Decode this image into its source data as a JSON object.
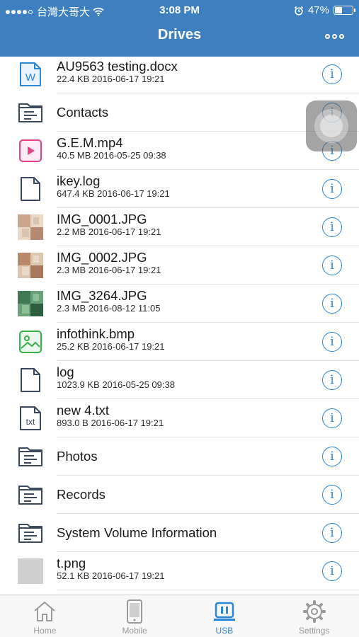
{
  "status_bar": {
    "carrier": "台灣大哥大",
    "time": "3:08 PM",
    "battery_level": 47,
    "battery_text": "47%"
  },
  "nav": {
    "title": "Drives",
    "more_icon": "more-dots-icon"
  },
  "files": [
    {
      "name": "AU9563 testing.docx",
      "meta": "22.4 KB 2016-06-17 19:21",
      "icon": "word-doc-icon"
    },
    {
      "name": "Contacts",
      "meta": "",
      "icon": "folder-icon"
    },
    {
      "name": "G.E.M.mp4",
      "meta": "40.5 MB 2016-05-25 09:38",
      "icon": "video-file-icon"
    },
    {
      "name": "ikey.log",
      "meta": "647.4 KB 2016-06-17 19:21",
      "icon": "file-icon"
    },
    {
      "name": "IMG_0001.JPG",
      "meta": "2.2 MB 2016-06-17 19:21",
      "icon": "photo-thumbnail"
    },
    {
      "name": "IMG_0002.JPG",
      "meta": "2.3 MB 2016-06-17 19:21",
      "icon": "photo-thumbnail"
    },
    {
      "name": "IMG_3264.JPG",
      "meta": "2.3 MB 2016-08-12 11:05",
      "icon": "photo-thumbnail"
    },
    {
      "name": "infothink.bmp",
      "meta": "25.2 KB 2016-06-17 19:21",
      "icon": "image-file-icon"
    },
    {
      "name": "log",
      "meta": "1023.9 KB 2016-05-25 09:38",
      "icon": "file-icon"
    },
    {
      "name": "new 4.txt",
      "meta": "893.0 B 2016-06-17 19:21",
      "icon": "txt-file-icon"
    },
    {
      "name": "Photos",
      "meta": "",
      "icon": "folder-icon"
    },
    {
      "name": "Records",
      "meta": "",
      "icon": "folder-icon"
    },
    {
      "name": "System Volume Information",
      "meta": "",
      "icon": "folder-icon"
    },
    {
      "name": "t.png",
      "meta": "52.1 KB 2016-06-17 19:21",
      "icon": "photo-thumbnail"
    }
  ],
  "info_glyph": "i",
  "txt_glyph": "txt",
  "word_glyph": "W",
  "tabs": [
    {
      "label": "Home",
      "icon": "home-icon",
      "active": false
    },
    {
      "label": "Mobile",
      "icon": "mobile-icon",
      "active": false
    },
    {
      "label": "USB",
      "icon": "usb-drive-icon",
      "active": true
    },
    {
      "label": "Settings",
      "icon": "gear-icon",
      "active": false
    }
  ],
  "colors": {
    "header": "#3e80bf",
    "accent": "#2a86d6",
    "folder_stroke": "#3a4a5c",
    "video_pink": "#e0418a",
    "image_green": "#3aae4a"
  }
}
